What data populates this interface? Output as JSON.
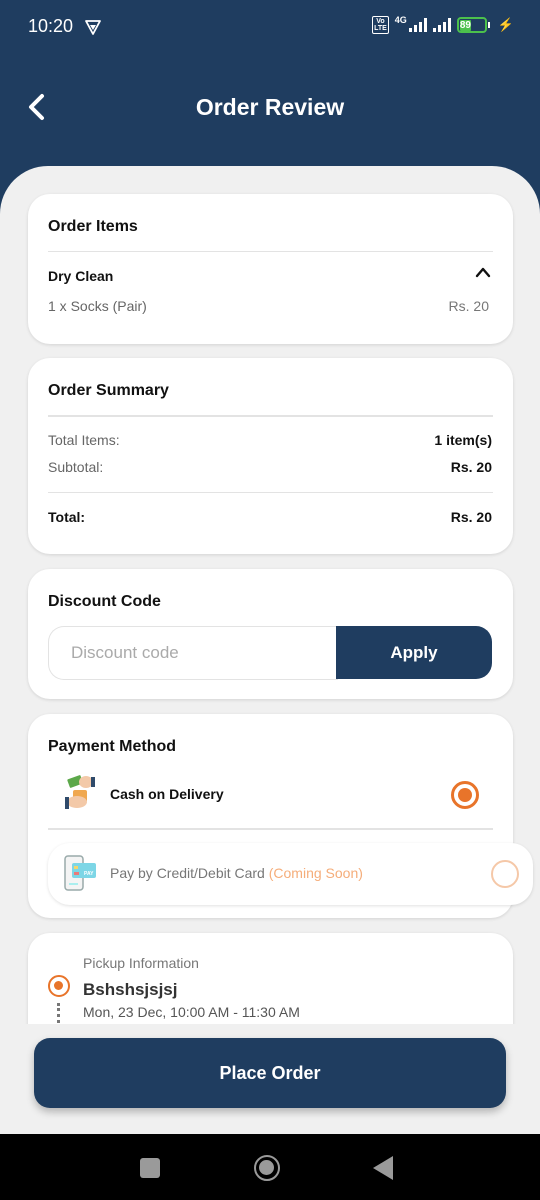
{
  "status_bar": {
    "time": "10:20",
    "network": "4G",
    "volte": "Vo LTE",
    "battery": "89"
  },
  "header": {
    "title": "Order Review"
  },
  "order_items": {
    "title": "Order Items",
    "category": "Dry Clean",
    "items": [
      {
        "line": "1 x Socks (Pair)",
        "price": "Rs. 20"
      }
    ]
  },
  "order_summary": {
    "title": "Order Summary",
    "total_items_label": "Total Items:",
    "total_items_value": "1 item(s)",
    "subtotal_label": "Subtotal:",
    "subtotal_value": "Rs. 20",
    "total_label": "Total:",
    "total_value": "Rs. 20"
  },
  "discount": {
    "title": "Discount Code",
    "placeholder": "Discount code",
    "value": "",
    "apply_label": "Apply"
  },
  "payment": {
    "title": "Payment Method",
    "options": [
      {
        "label": "Cash on Delivery",
        "suffix": "",
        "selected": true
      },
      {
        "label": "Pay by Credit/Debit Card",
        "suffix": "(Coming Soon)",
        "selected": false
      }
    ]
  },
  "pickup": {
    "label": "Pickup Information",
    "name": "Bshshsjsjsj",
    "time": "Mon, 23 Dec, 10:00 AM - 11:30 AM"
  },
  "footer": {
    "place_order_label": "Place Order"
  },
  "colors": {
    "primary": "#1f3d60",
    "accent": "#e8742a",
    "coming_soon": "#f5ad7a",
    "background": "#f0f0f0"
  }
}
